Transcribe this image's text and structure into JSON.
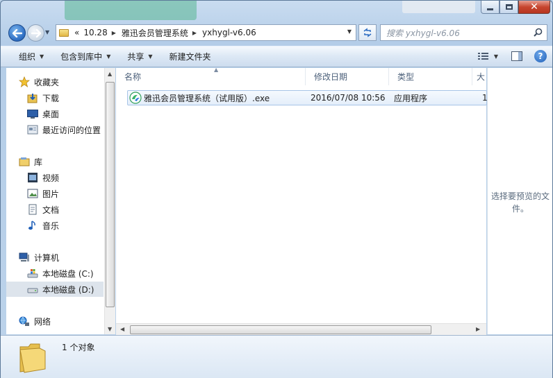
{
  "window": {
    "close_glyph": "✕"
  },
  "address_bar": {
    "overflow": "«",
    "crumbs": [
      "10.28",
      "雅迅会员管理系统",
      "yxhygl-v6.06"
    ]
  },
  "search": {
    "placeholder": "搜索 yxhygl-v6.06"
  },
  "toolbar": {
    "organize": "组织",
    "include_in_library": "包含到库中",
    "share": "共享",
    "new_folder": "新建文件夹",
    "help_glyph": "?"
  },
  "nav_pane": {
    "favorites": "收藏夹",
    "downloads": "下载",
    "desktop": "桌面",
    "recent": "最近访问的位置",
    "libraries": "库",
    "videos": "视频",
    "pictures": "图片",
    "documents": "文档",
    "music": "音乐",
    "computer": "计算机",
    "drive_c": "本地磁盘 (C:)",
    "drive_d": "本地磁盘 (D:)",
    "network": "网络"
  },
  "columns": {
    "name": "名称",
    "date": "修改日期",
    "type": "类型",
    "size": "大"
  },
  "files": [
    {
      "name": "雅迅会员管理系统（试用版）.exe",
      "date": "2016/07/08 10:56",
      "type": "应用程序",
      "size": "1"
    }
  ],
  "preview": {
    "empty_text": "选择要预览的文件。"
  },
  "details": {
    "count": "1 个对象"
  },
  "colors": {
    "accent": "#2c6cc2",
    "selection": "#dde4ec",
    "frame": "#bcd3ea"
  }
}
